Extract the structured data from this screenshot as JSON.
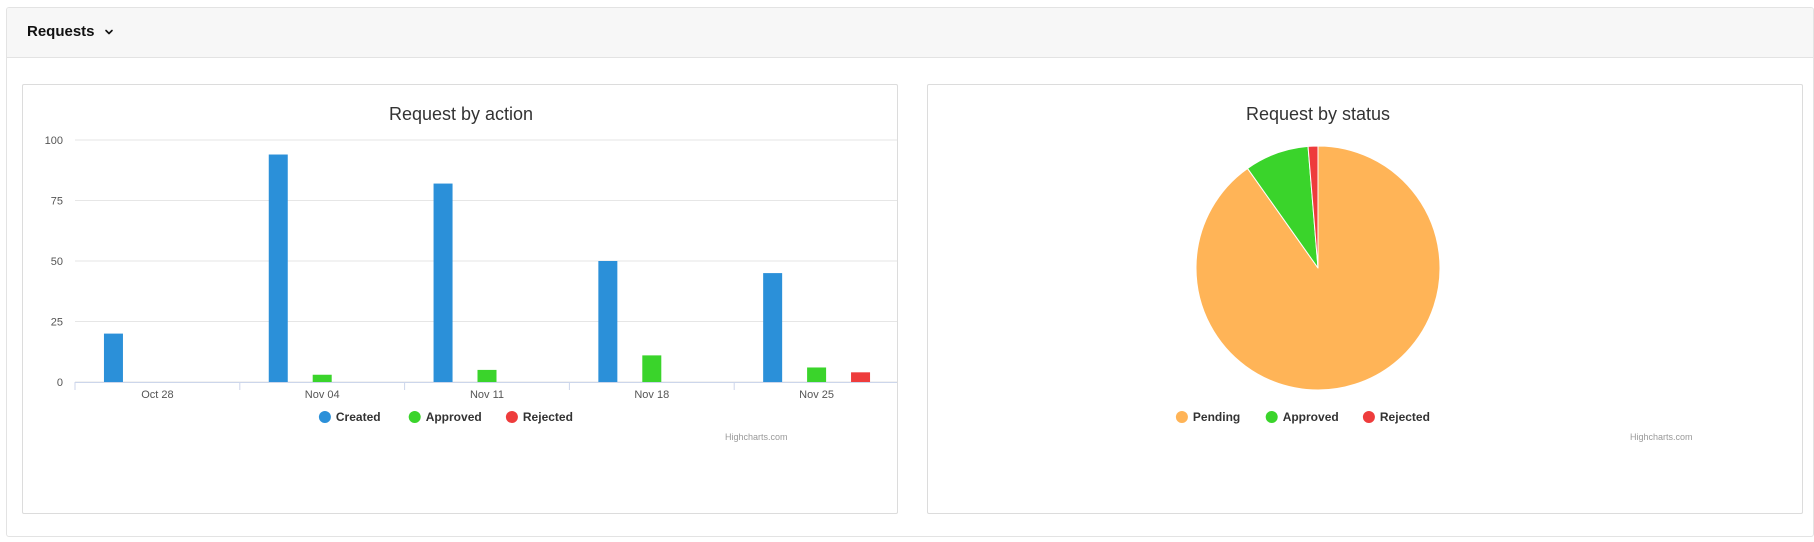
{
  "section": {
    "title": "Requests",
    "toggle_icon": "chevron-down-icon"
  },
  "credits": "Highcharts.com",
  "chart_data": [
    {
      "type": "bar",
      "title": "Request by action",
      "categories": [
        "Oct 28",
        "Nov 04",
        "Nov 11",
        "Nov 18",
        "Nov 25"
      ],
      "ylim": [
        0,
        100
      ],
      "yticks": [
        0,
        25,
        50,
        75,
        100
      ],
      "grid": true,
      "legend_position": "bottom-center",
      "series": [
        {
          "name": "Created",
          "color": "#2b90d9",
          "values": [
            20,
            94,
            82,
            50,
            45
          ]
        },
        {
          "name": "Approved",
          "color": "#3ad42b",
          "values": [
            0,
            3,
            5,
            11,
            6
          ]
        },
        {
          "name": "Rejected",
          "color": "#ee3c3c",
          "values": [
            0,
            0,
            0,
            0,
            4
          ]
        }
      ]
    },
    {
      "type": "pie",
      "title": "Request by status",
      "legend_position": "bottom-center",
      "slices": [
        {
          "name": "Pending",
          "color": "#ffb457",
          "value": 90.2
        },
        {
          "name": "Approved",
          "color": "#3ad42b",
          "value": 8.5
        },
        {
          "name": "Rejected",
          "color": "#ee3c3c",
          "value": 1.3
        }
      ]
    }
  ]
}
